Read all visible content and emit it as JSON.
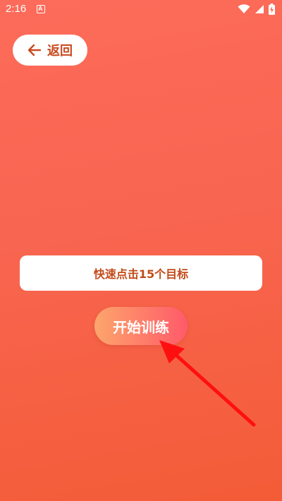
{
  "status_bar": {
    "time": "2:16",
    "icons": [
      "notification-a-icon",
      "wifi-icon",
      "signal-icon",
      "battery-charging-icon"
    ]
  },
  "back_button": {
    "label": "返回",
    "icon": "arrow-left-icon"
  },
  "instruction": {
    "text": "快速点击15个目标"
  },
  "start_button": {
    "label": "开始训练"
  },
  "colors": {
    "background_top": "#fd6b5a",
    "background_bottom": "#f45c37",
    "accent_text": "#c84a20",
    "start_gradient_left": "#fca66c",
    "start_gradient_right": "#ff5a6a",
    "annotation_arrow": "#ff0000"
  }
}
